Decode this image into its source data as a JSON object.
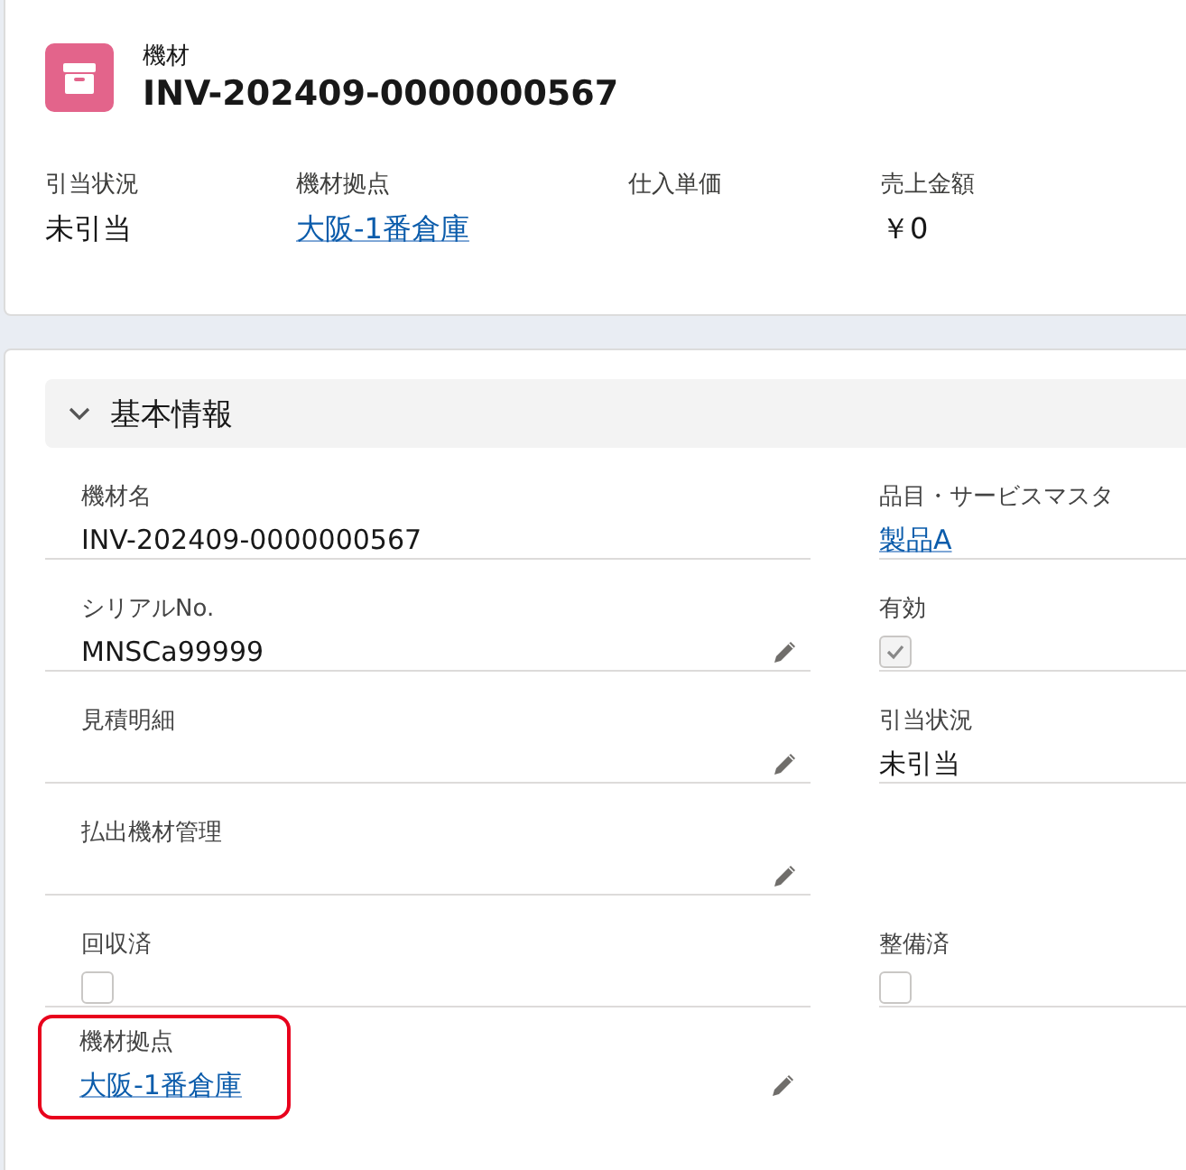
{
  "header": {
    "object_type": "機材",
    "title": "INV-202409-0000000567",
    "fields": [
      {
        "label": "引当状況",
        "value": "未引当",
        "kind": "text"
      },
      {
        "label": "機材拠点",
        "value": "大阪-1番倉庫",
        "kind": "link"
      },
      {
        "label": "仕入単価",
        "kind": "empty"
      },
      {
        "label": "売上金額",
        "value": "￥0",
        "kind": "text"
      }
    ]
  },
  "section": {
    "title": "基本情報",
    "expanded": true,
    "rows": [
      {
        "left": {
          "label": "機材名",
          "kind": "text",
          "value": "INV-202409-0000000567",
          "editable": false,
          "highlighted": false
        },
        "right": {
          "label": "品目・サービスマスタ",
          "kind": "link",
          "value": "製品A",
          "editable": false,
          "highlighted": false
        }
      },
      {
        "left": {
          "label": "シリアルNo.",
          "kind": "text",
          "value": "MNSCa99999",
          "editable": true,
          "highlighted": false
        },
        "right": {
          "label": "有効",
          "kind": "checkbox",
          "checked": true,
          "disabled": true,
          "editable": false,
          "highlighted": false
        }
      },
      {
        "left": {
          "label": "見積明細",
          "kind": "empty",
          "editable": true,
          "highlighted": false
        },
        "right": {
          "label": "引当状況",
          "kind": "text",
          "value": "未引当",
          "editable": false,
          "highlighted": false
        }
      },
      {
        "left": {
          "label": "払出機材管理",
          "kind": "empty",
          "editable": true,
          "highlighted": false
        }
      },
      {
        "left": {
          "label": "回収済",
          "kind": "checkbox",
          "checked": false,
          "disabled": false,
          "editable": false,
          "highlighted": false
        },
        "right": {
          "label": "整備済",
          "kind": "checkbox",
          "checked": false,
          "disabled": false,
          "editable": false,
          "highlighted": false
        }
      },
      {
        "left": {
          "label": "機材拠点",
          "kind": "link",
          "value": "大阪-1番倉庫",
          "editable": true,
          "highlighted": true
        }
      }
    ]
  }
}
